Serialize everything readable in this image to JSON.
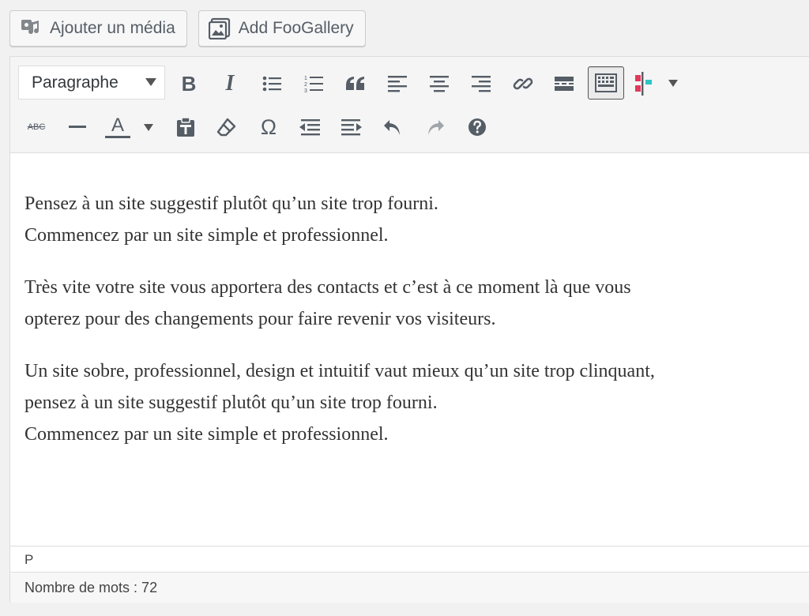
{
  "media_buttons": {
    "add_media": {
      "label": "Ajouter un média",
      "icon": "media-icon"
    },
    "add_foogallery": {
      "label": "Add FooGallery",
      "icon": "gallery-icon"
    }
  },
  "toolbar": {
    "format_select": {
      "value": "Paragraphe",
      "icon": "chevron-down-icon"
    },
    "row1": [
      "bold-icon",
      "italic-icon",
      "bulleted-list-icon",
      "numbered-list-icon",
      "blockquote-icon",
      "align-left-icon",
      "align-center-icon",
      "align-right-icon",
      "link-icon",
      "read-more-icon",
      "toolbar-toggle-icon",
      "table-of-contents-icon"
    ],
    "row2": [
      "strikethrough-icon",
      "horizontal-rule-icon",
      "text-color-icon",
      "paste-as-text-icon",
      "clear-formatting-icon",
      "special-character-icon",
      "decrease-indent-icon",
      "increase-indent-icon",
      "undo-icon",
      "redo-icon",
      "help-icon"
    ],
    "glyphs": {
      "bold": "B",
      "italic": "I",
      "strikethrough": "ABC",
      "text_color": "A",
      "omega": "Ω"
    },
    "colors": {
      "icon": "#555d66",
      "icon_disabled": "#a0a5aa",
      "toc_red": "#e03a5d",
      "toc_teal": "#2ec4c4"
    }
  },
  "content": {
    "paragraphs": [
      [
        "Pensez à un site suggestif plutôt qu’un site trop fourni.",
        "Commencez par un site simple et professionnel."
      ],
      [
        "Très vite votre site vous apportera des contacts et c’est à ce moment là que vous",
        "opterez pour des changements pour faire revenir vos visiteurs."
      ],
      [
        "Un site sobre, professionnel, design et intuitif vaut mieux qu’un site trop clinquant,",
        "pensez à un site suggestif plutôt qu’un site trop fourni.",
        "Commencez par un site simple et professionnel."
      ]
    ]
  },
  "path_bar": {
    "element": "P"
  },
  "status_bar": {
    "word_count": "Nombre de mots : 72"
  }
}
